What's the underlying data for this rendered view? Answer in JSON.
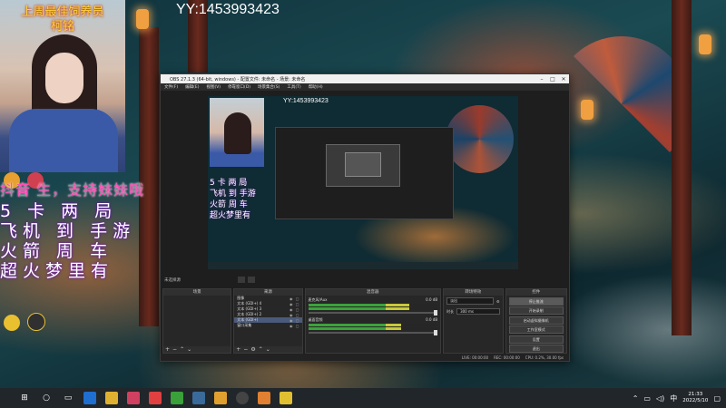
{
  "stream_overlay": {
    "yy_id": "YY:1453993423",
    "webcam_caption": [
      "上周最佳饲养员",
      "柯铭"
    ],
    "promo_line": "抖音 生，支持妹妹哦",
    "lines": [
      "5 卡 两 局",
      "飞机 到 手游",
      "火箭 周 车",
      "超火梦里有"
    ]
  },
  "obs": {
    "title": "OBS 27.1.3 (64-bit, windows) - 配置文件: 未命名 - 场景: 未命名",
    "menu": [
      "文件(F)",
      "编辑(E)",
      "视图(V)",
      "停靠窗口(D)",
      "场景集合(S)",
      "工具(T)",
      "帮助(H)"
    ],
    "preview_yy": "YY:1453993423",
    "scene_bar_label": "未选择源",
    "docks": {
      "scenes_header": "场景",
      "sources_header": "来源",
      "mixer_header": "混音器",
      "transitions_header": "转场特效",
      "controls_header": "控件"
    },
    "sources": [
      {
        "name": "图像",
        "selected": false
      },
      {
        "name": "文本 (GDI+) 4",
        "selected": false
      },
      {
        "name": "文本 (GDI+) 3",
        "selected": false
      },
      {
        "name": "文本 (GDI+) 2",
        "selected": false
      },
      {
        "name": "文本 (GDI+)",
        "selected": true
      },
      {
        "name": "窗口采集",
        "selected": false
      }
    ],
    "mixer": [
      {
        "name": "麦克风/Aux",
        "db": "0.0 dB",
        "level": 0.78
      },
      {
        "name": "桌面音频",
        "db": "0.0 dB",
        "level": 0.72
      }
    ],
    "transition": {
      "type": "淡出",
      "duration_label": "时长",
      "duration": "300 ms"
    },
    "controls": [
      "停止推流",
      "开始录制",
      "启动虚拟摄像机",
      "工作室模式",
      "设置",
      "退出"
    ],
    "status": {
      "live": "LIVE: 00:00:00",
      "rec": "REC: 00:00:00",
      "cpu": "CPU: 0.2%, 30.00 fps"
    }
  },
  "taskbar": {
    "time": "21:33",
    "date": "2022/5/10",
    "colors": {
      "bar": "#20262a",
      "accent": "#1e6fd0"
    }
  }
}
